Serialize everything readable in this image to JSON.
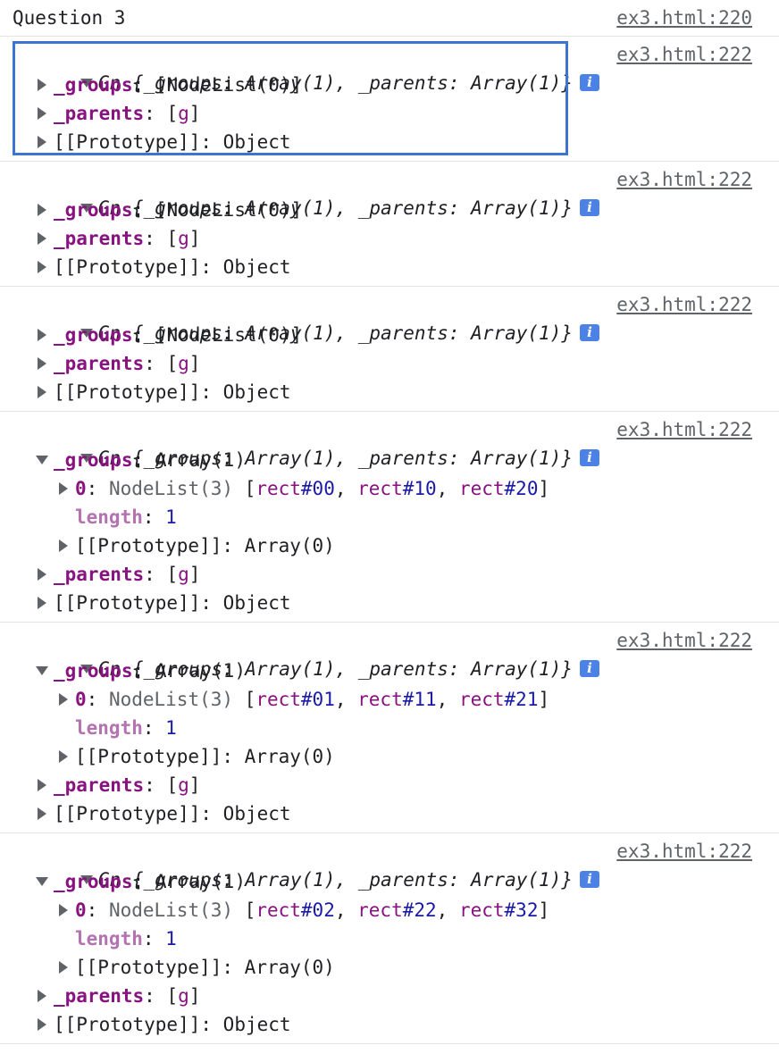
{
  "console": {
    "header": {
      "text": "Question 3",
      "source": "ex3.html:220"
    },
    "messages": [
      {
        "summary": {
          "ctor": "Gn",
          "open": " {",
          "groups_key": "_groups",
          "groups_val": "Array(1)",
          "sep": ", ",
          "parents_key": "_parents",
          "parents_val": "Array(1)",
          "close": "}"
        },
        "source": "ex3.html:222",
        "groups": {
          "key": "_groups",
          "value": "[NodeList(0)]"
        },
        "parents": {
          "key": "_parents",
          "value": "[g]"
        },
        "proto": {
          "key": "[[Prototype]]",
          "value": "Object"
        }
      },
      {
        "summary": {
          "ctor": "Gn",
          "open": " {",
          "groups_key": "_groups",
          "groups_val": "Array(1)",
          "sep": ", ",
          "parents_key": "_parents",
          "parents_val": "Array(1)",
          "close": "}"
        },
        "source": "ex3.html:222",
        "groups": {
          "key": "_groups",
          "value": "[NodeList(0)]"
        },
        "parents": {
          "key": "_parents",
          "value": "[g]"
        },
        "proto": {
          "key": "[[Prototype]]",
          "value": "Object"
        }
      },
      {
        "summary": {
          "ctor": "Gn",
          "open": " {",
          "groups_key": "_groups",
          "groups_val": "Array(1)",
          "sep": ", ",
          "parents_key": "_parents",
          "parents_val": "Array(1)",
          "close": "}"
        },
        "source": "ex3.html:222",
        "groups": {
          "key": "_groups",
          "value": "[NodeList(0)]"
        },
        "parents": {
          "key": "_parents",
          "value": "[g]"
        },
        "proto": {
          "key": "[[Prototype]]",
          "value": "Object"
        }
      },
      {
        "summary": {
          "ctor": "Gn",
          "open": " {",
          "groups_key": "_groups",
          "groups_val": "Array(1)",
          "sep": ", ",
          "parents_key": "_parents",
          "parents_val": "Array(1)",
          "close": "}"
        },
        "source": "ex3.html:222",
        "groups": {
          "key": "_groups",
          "value": "Array(1)",
          "item0": {
            "key": "0",
            "type": "NodeList(3)",
            "nodes": [
              "rect",
              "#00",
              "rect",
              "#10",
              "rect",
              "#20"
            ]
          },
          "length": {
            "key": "length",
            "value": "1"
          },
          "proto": {
            "key": "[[Prototype]]",
            "value": "Array(0)"
          }
        },
        "parents": {
          "key": "_parents",
          "value": "[g]"
        },
        "proto": {
          "key": "[[Prototype]]",
          "value": "Object"
        }
      },
      {
        "summary": {
          "ctor": "Gn",
          "open": " {",
          "groups_key": "_groups",
          "groups_val": "Array(1)",
          "sep": ", ",
          "parents_key": "_parents",
          "parents_val": "Array(1)",
          "close": "}"
        },
        "source": "ex3.html:222",
        "groups": {
          "key": "_groups",
          "value": "Array(1)",
          "item0": {
            "key": "0",
            "type": "NodeList(3)",
            "nodes": [
              "rect",
              "#01",
              "rect",
              "#11",
              "rect",
              "#21"
            ]
          },
          "length": {
            "key": "length",
            "value": "1"
          },
          "proto": {
            "key": "[[Prototype]]",
            "value": "Array(0)"
          }
        },
        "parents": {
          "key": "_parents",
          "value": "[g]"
        },
        "proto": {
          "key": "[[Prototype]]",
          "value": "Object"
        }
      },
      {
        "summary": {
          "ctor": "Gn",
          "open": " {",
          "groups_key": "_groups",
          "groups_val": "Array(1)",
          "sep": ", ",
          "parents_key": "_parents",
          "parents_val": "Array(1)",
          "close": "}"
        },
        "source": "ex3.html:222",
        "groups": {
          "key": "_groups",
          "value": "Array(1)",
          "item0": {
            "key": "0",
            "type": "NodeList(3)",
            "nodes": [
              "rect",
              "#02",
              "rect",
              "#22",
              "rect",
              "#32"
            ]
          },
          "length": {
            "key": "length",
            "value": "1"
          },
          "proto": {
            "key": "[[Prototype]]",
            "value": "Array(0)"
          }
        },
        "parents": {
          "key": "_parents",
          "value": "[g]"
        },
        "proto": {
          "key": "[[Prototype]]",
          "value": "Object"
        }
      }
    ],
    "icons": {
      "info": "info-icon",
      "expanded": "triangle-down-icon",
      "collapsed": "triangle-right-icon"
    },
    "colors": {
      "key": "#881280",
      "number": "#1a1aa6",
      "link": "#5f6368",
      "selection": "#3b74d2",
      "info_badge": "#4c82e6"
    }
  }
}
